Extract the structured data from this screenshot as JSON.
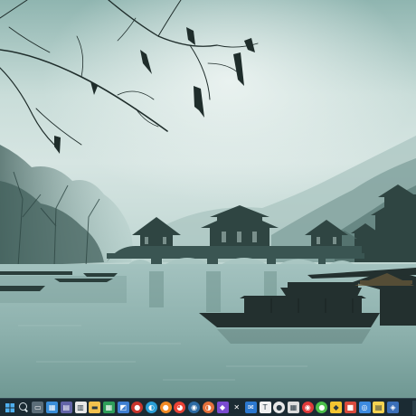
{
  "desktop": {
    "wallpaper_icon": "landscape-wallpaper"
  },
  "taskbar": {
    "bg_color": "#1b2b33",
    "icons": [
      {
        "name": "start-icon",
        "shape": "start",
        "color": "#1b2b33",
        "glyph": ""
      },
      {
        "name": "search-icon",
        "shape": "search",
        "color": "#1b2b33",
        "glyph": ""
      },
      {
        "name": "task-view-icon",
        "shape": "rounded",
        "color": "#5b6d78",
        "glyph": "▭"
      },
      {
        "name": "widgets-icon",
        "shape": "rounded",
        "color": "#3a8ed8",
        "glyph": "▦"
      },
      {
        "name": "teams-chat-icon",
        "shape": "rounded",
        "color": "#6264a7",
        "glyph": "▤"
      },
      {
        "name": "calendar-app-icon",
        "shape": "rounded",
        "color": "#e8e8e8",
        "glyph": "▥"
      },
      {
        "name": "file-explorer-icon",
        "shape": "rounded",
        "color": "#f2c14e",
        "glyph": "▬"
      },
      {
        "name": "spreadsheet-app-icon",
        "shape": "rounded",
        "color": "#2f9e5a",
        "glyph": "▦"
      },
      {
        "name": "photos-app-icon",
        "shape": "rounded",
        "color": "#3f7fd1",
        "glyph": "◩"
      },
      {
        "name": "browser-app-icon",
        "shape": "circle",
        "color": "#c8352c",
        "glyph": "●"
      },
      {
        "name": "edge-browser-icon",
        "shape": "circle",
        "color": "#2a9ed6",
        "glyph": "◐"
      },
      {
        "name": "firefox-browser-icon",
        "shape": "circle",
        "color": "#f08a24",
        "glyph": "●"
      },
      {
        "name": "chrome-browser-icon",
        "shape": "circle",
        "color": "#e94235",
        "glyph": "◕"
      },
      {
        "name": "steam-app-icon",
        "shape": "circle",
        "color": "#2c6aa3",
        "glyph": "◉"
      },
      {
        "name": "media-app-icon",
        "shape": "circle",
        "color": "#e4703a",
        "glyph": "◑"
      },
      {
        "name": "purple-app-icon",
        "shape": "rounded",
        "color": "#7a4bd0",
        "glyph": "◆"
      },
      {
        "name": "vscode-icon",
        "shape": "rounded",
        "color": "#1b2b33",
        "glyph": "✕"
      },
      {
        "name": "mail-app-icon",
        "shape": "rounded",
        "color": "#2c78cf",
        "glyph": "✉"
      },
      {
        "name": "text-editor-icon",
        "shape": "rounded",
        "color": "#f0f0f0",
        "glyph": "T"
      },
      {
        "name": "chat-bubble-icon",
        "shape": "circle",
        "color": "#e8e8e8",
        "glyph": "●"
      },
      {
        "name": "grid-app-icon",
        "shape": "rounded",
        "color": "#dcdcdc",
        "glyph": "▦"
      },
      {
        "name": "red-circle-app-icon",
        "shape": "circle",
        "color": "#e03a3a",
        "glyph": "◉"
      },
      {
        "name": "green-circle-app-icon",
        "shape": "circle",
        "color": "#4cbf4a",
        "glyph": "●"
      },
      {
        "name": "yellow-app-icon",
        "shape": "rounded",
        "color": "#f3c431",
        "glyph": "◆"
      },
      {
        "name": "red-app-icon",
        "shape": "rounded",
        "color": "#d94b3d",
        "glyph": "■"
      },
      {
        "name": "blue-app-icon",
        "shape": "rounded",
        "color": "#3d8be0",
        "glyph": "◎"
      },
      {
        "name": "notes-app-icon",
        "shape": "rounded",
        "color": "#f4d250",
        "glyph": "▤"
      },
      {
        "name": "tray-app-icon",
        "shape": "rounded",
        "color": "#3b6fb8",
        "glyph": "◈"
      }
    ]
  }
}
